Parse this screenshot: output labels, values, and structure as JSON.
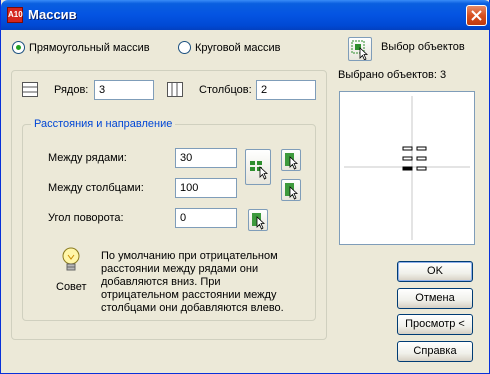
{
  "window": {
    "title": "Массив",
    "app_icon_text": "A10"
  },
  "mode": {
    "rect_label": "Прямоугольный массив",
    "polar_label": "Круговой массив",
    "selected": "rect"
  },
  "grid": {
    "rows_label": "Рядов:",
    "rows_value": "3",
    "cols_label": "Столбцов:",
    "cols_value": "2"
  },
  "offsets": {
    "group_title": "Расстояния и направление",
    "row_offset_label": "Между рядами:",
    "row_offset_value": "30",
    "col_offset_label": "Между столбцами:",
    "col_offset_value": "100",
    "angle_label": "Угол поворота:",
    "angle_value": "0"
  },
  "tip": {
    "caption": "Совет",
    "text": "По умолчанию при отрицательном расстоянии между рядами они добавляются вниз. При отрицательном расстоянии между столбцами они добавляются влево."
  },
  "selection": {
    "button_label": "Выбор объектов",
    "count_text": "Выбрано объектов: 3"
  },
  "buttons": {
    "ok": "OK",
    "cancel": "Отмена",
    "preview": "Просмотр <",
    "help": "Справка"
  }
}
